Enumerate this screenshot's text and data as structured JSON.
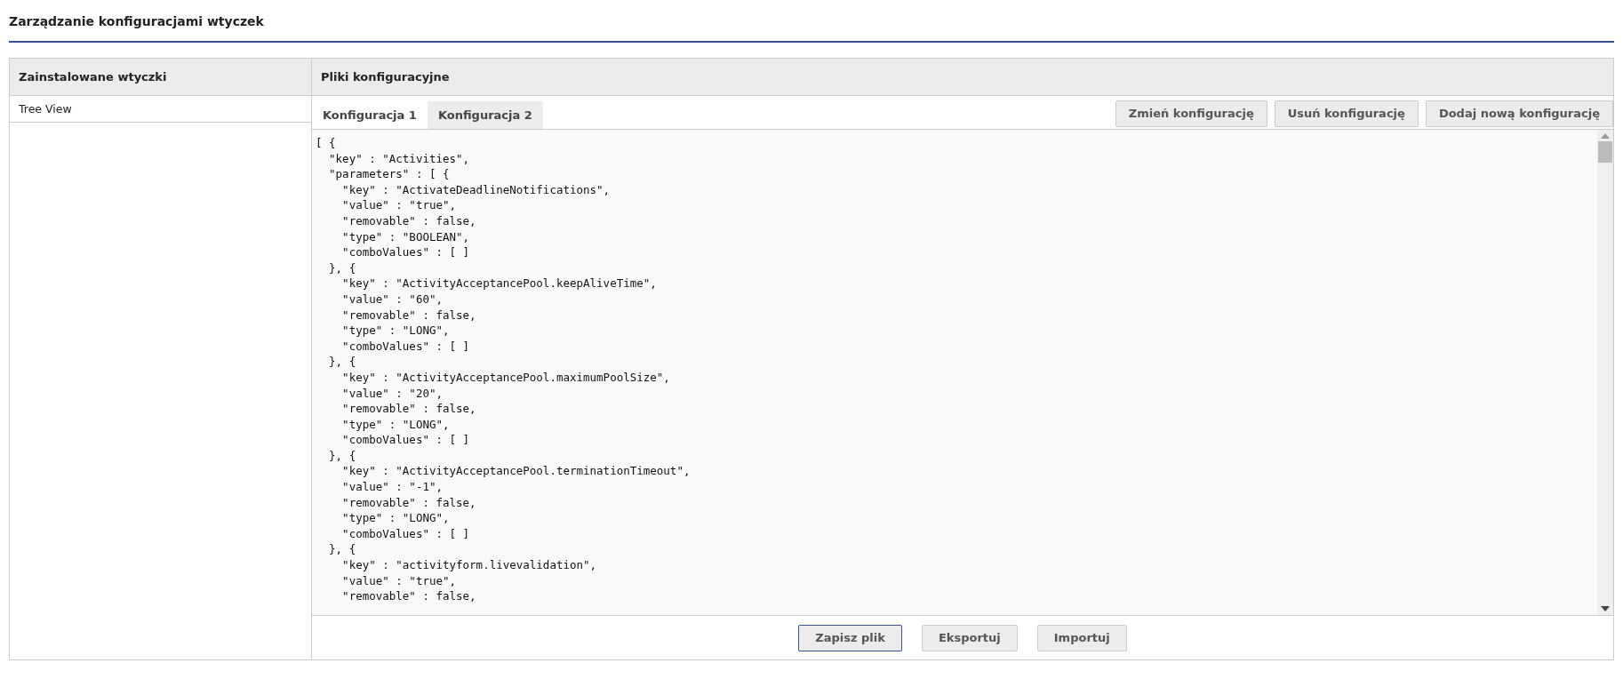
{
  "page": {
    "title": "Zarządzanie konfiguracjami wtyczek"
  },
  "plugins": {
    "heading": "Zainstalowane wtyczki",
    "items": [
      {
        "label": "Tree View",
        "selected": false
      }
    ]
  },
  "config": {
    "heading": "Pliki konfiguracyjne",
    "tabs": [
      {
        "label": "Konfiguracja 1",
        "selected": true
      },
      {
        "label": "Konfiguracja 2",
        "selected": false
      }
    ],
    "actions": [
      "Zmień konfigurację",
      "Usuń konfigurację",
      "Dodaj nową konfigurację"
    ],
    "code_lines": [
      "[ {",
      "  \"key\" : \"Activities\",",
      "  \"parameters\" : [ {",
      "    \"key\" : \"ActivateDeadlineNotifications\",",
      "    \"value\" : \"true\",",
      "    \"removable\" : false,",
      "    \"type\" : \"BOOLEAN\",",
      "    \"comboValues\" : [ ]",
      "  }, {",
      "    \"key\" : \"ActivityAcceptancePool.keepAliveTime\",",
      "    \"value\" : \"60\",",
      "    \"removable\" : false,",
      "    \"type\" : \"LONG\",",
      "    \"comboValues\" : [ ]",
      "  }, {",
      "    \"key\" : \"ActivityAcceptancePool.maximumPoolSize\",",
      "    \"value\" : \"20\",",
      "    \"removable\" : false,",
      "    \"type\" : \"LONG\",",
      "    \"comboValues\" : [ ]",
      "  }, {",
      "    \"key\" : \"ActivityAcceptancePool.terminationTimeout\",",
      "    \"value\" : \"-1\",",
      "    \"removable\" : false,",
      "    \"type\" : \"LONG\",",
      "    \"comboValues\" : [ ]",
      "  }, {",
      "    \"key\" : \"activityform.livevalidation\",",
      "    \"value\" : \"true\",",
      "    \"removable\" : false,"
    ],
    "footer_buttons": [
      {
        "label": "Zapisz plik",
        "kind": "primary"
      },
      {
        "label": "Eksportuj",
        "kind": "normal"
      },
      {
        "label": "Importuj",
        "kind": "normal"
      }
    ]
  }
}
